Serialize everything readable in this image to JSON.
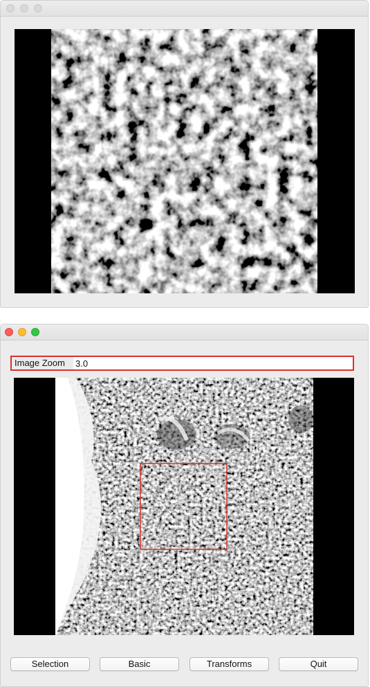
{
  "window1": {
    "title_bar_buttons": [
      "close",
      "minimize",
      "maximize"
    ],
    "controls_state": "inactive",
    "viewer": {
      "content": "grayscale noisy micrograph (zoomed region)"
    }
  },
  "window2": {
    "controls_state": "active",
    "colors": {
      "close": "#fc5f57",
      "minimize": "#fdbc2e",
      "maximize": "#33c748",
      "highlight": "#d7322d"
    },
    "zoom": {
      "label": "Image Zoom",
      "value": "3.0"
    },
    "viewer": {
      "content": "grayscale micrograph overview with selection box"
    },
    "buttons": {
      "selection": "Selection",
      "basic": "Basic",
      "transforms": "Transforms",
      "quit": "Quit"
    }
  }
}
